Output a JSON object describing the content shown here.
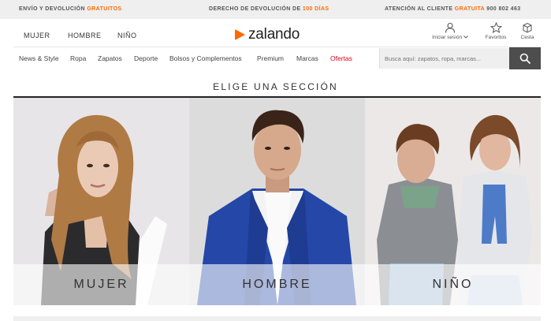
{
  "topbar": {
    "shipping_prefix": "ENVÍO Y DEVOLUCIÓN",
    "shipping_highlight": "GRATUITOS",
    "return_prefix": "DERECHO DE DEVOLUCIÓN DE",
    "return_highlight": "100 DÍAS",
    "service_prefix": "ATENCIÓN AL CLIENTE",
    "service_highlight": "GRATUITA",
    "service_phone": "900 802 463",
    "highlight_color": "#ff6900"
  },
  "header": {
    "gender_links": [
      "MUJER",
      "HOMBRE",
      "NIÑO"
    ],
    "logo_text": "zalando",
    "account_label": "Iniciar sesión",
    "favorites_label": "Favoritos",
    "cart_label": "Cesta",
    "icons": [
      "user-icon",
      "chevron-down-icon",
      "star-icon",
      "bag-icon"
    ]
  },
  "nav": {
    "items": [
      "News & Style",
      "Ropa",
      "Zapatos",
      "Deporte",
      "Bolsos y Complementos",
      "Premium",
      "Marcas",
      "Ofertas"
    ],
    "sale_color": "#e2001a",
    "search_placeholder": "Busca aquí: zapatos, ropa, marcas...",
    "search_icon": "search-icon"
  },
  "main": {
    "title": "ELIGE UNA SECCIÓN",
    "sections": [
      {
        "label": "MUJER"
      },
      {
        "label": "HOMBRE"
      },
      {
        "label": "NIÑO"
      }
    ]
  }
}
